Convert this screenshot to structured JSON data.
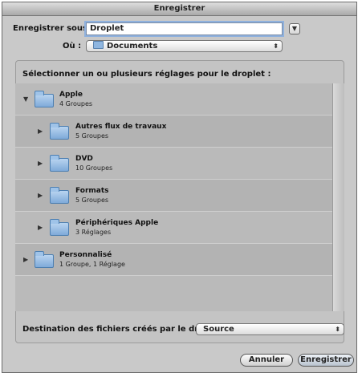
{
  "window": {
    "title": "Enregistrer"
  },
  "save_as": {
    "label": "Enregistrer sous :",
    "value": "Droplet"
  },
  "location": {
    "label": "Où :",
    "value": "Documents"
  },
  "presets": {
    "heading": "Sélectionner un ou plusieurs réglages pour le droplet :",
    "items": [
      {
        "title": "Apple",
        "subtitle": "4 Groupes",
        "expanded": true
      },
      {
        "title": "Autres flux de travaux",
        "subtitle": "5 Groupes",
        "expanded": false
      },
      {
        "title": "DVD",
        "subtitle": "10 Groupes",
        "expanded": false
      },
      {
        "title": "Formats",
        "subtitle": "5 Groupes",
        "expanded": false
      },
      {
        "title": "Périphériques Apple",
        "subtitle": "3 Réglages",
        "expanded": false
      },
      {
        "title": "Personnalisé",
        "subtitle": "1 Groupe, 1 Réglage",
        "expanded": false
      }
    ]
  },
  "destination": {
    "label": "Destination des fichiers créés par le droplet :",
    "value": "Source"
  },
  "buttons": {
    "cancel": "Annuler",
    "save": "Enregistrer"
  },
  "icons": {
    "expand": "chevron-down-icon",
    "collapsed": "chevron-right-icon",
    "folder": "folder-icon",
    "popup_arrows": "updown-arrows-icon"
  },
  "colors": {
    "window_bg": "#c9c9c9",
    "list_bg": "#bababa",
    "folder": "#8fb6e0"
  }
}
